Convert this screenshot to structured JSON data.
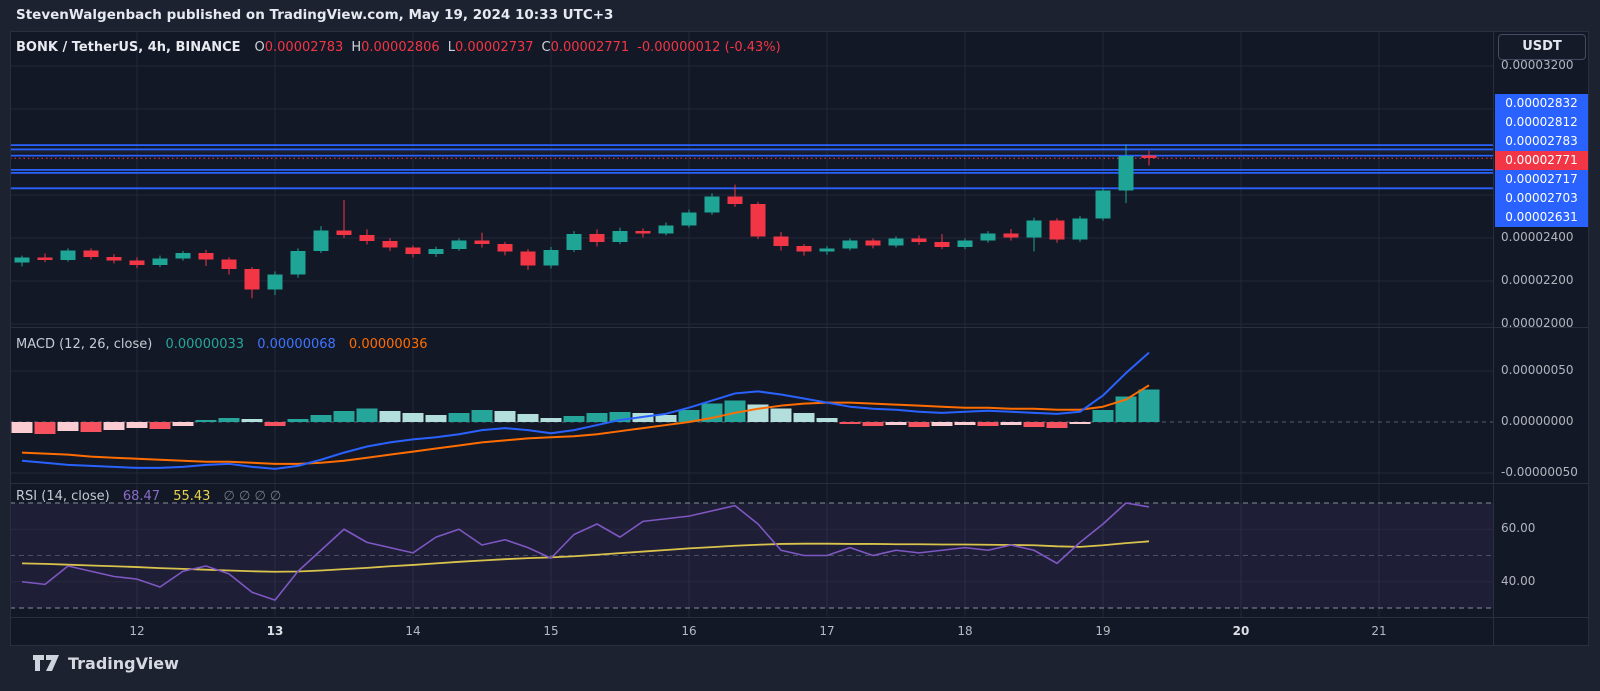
{
  "attribution": "StevenWalgenbach published on TradingView.com, May 19, 2024 10:33 UTC+3",
  "header": {
    "symbol": "BONK / TetherUS, 4h, BINANCE",
    "ohlc": [
      {
        "label": "O",
        "value": "0.00002783"
      },
      {
        "label": "H",
        "value": "0.00002806"
      },
      {
        "label": "L",
        "value": "0.00002737"
      },
      {
        "label": "C",
        "value": "0.00002771"
      }
    ],
    "change": "-0.00000012 (-0.43%)"
  },
  "price_scale_button": "USDT",
  "logo_text": "TradingView",
  "colors": {
    "up": "#1fa595",
    "down": "#f23645",
    "level_line": "#2962ff",
    "level_label_bg": "#2962ff",
    "last_price_bg": "#f23645",
    "macd_line": "#2962ff",
    "signal_line": "#ff6d00",
    "hist_up": "#26a69a",
    "hist_up_weak": "#b2dfdb",
    "hist_down": "#f7525f",
    "hist_down_weak": "#fbcdd2",
    "rsi_line": "#7e57c2",
    "rsi_ma": "#d9c34c",
    "band_fill": "rgba(126,87,194,0.10)",
    "grid": "#212839",
    "axis_text": "#b2b5be"
  },
  "price_axis": {
    "ticks": [
      {
        "value": 3200,
        "label": "0.00003200"
      },
      {
        "value": 2400,
        "label": "0.00002400"
      },
      {
        "value": 2200,
        "label": "0.00002200"
      },
      {
        "value": 2000,
        "label": "0.00002000"
      }
    ],
    "grid_ticks": [
      3200,
      3000,
      2800,
      2600,
      2400,
      2200,
      2000
    ],
    "level_labels": [
      {
        "text": "0.00002832",
        "style": "level"
      },
      {
        "text": "0.00002812",
        "style": "level"
      },
      {
        "text": "0.00002783",
        "style": "level"
      },
      {
        "text": "0.00002771",
        "style": "last"
      },
      {
        "text": "0.00002717",
        "style": "level"
      },
      {
        "text": "0.00002703",
        "style": "level"
      },
      {
        "text": "0.00002631",
        "style": "level"
      }
    ]
  },
  "macd_axis_ticks": [
    {
      "value": 50,
      "label": "0.00000050"
    },
    {
      "value": 0,
      "label": "0.00000000"
    },
    {
      "value": -50,
      "label": "-0.00000050"
    }
  ],
  "rsi_axis_ticks": [
    {
      "value": 60,
      "label": "60.00"
    },
    {
      "value": 40,
      "label": "40.00"
    }
  ],
  "time_axis": {
    "labels": [
      {
        "text": "12",
        "bold": false
      },
      {
        "text": "13",
        "bold": true
      },
      {
        "text": "14",
        "bold": false
      },
      {
        "text": "15",
        "bold": false
      },
      {
        "text": "16",
        "bold": false
      },
      {
        "text": "17",
        "bold": false
      },
      {
        "text": "18",
        "bold": false
      },
      {
        "text": "19",
        "bold": false
      },
      {
        "text": "20",
        "bold": true
      },
      {
        "text": "21",
        "bold": false
      }
    ]
  },
  "macd_legend": {
    "title": "MACD (12, 26, close)",
    "hist_value": "0.00000033",
    "macd_value": "0.00000068",
    "signal_value": "0.00000036"
  },
  "rsi_legend": {
    "title": "RSI (14, close)",
    "rsi_value": "68.47",
    "ma_value": "55.43",
    "empty_slots": "∅  ∅  ∅  ∅"
  },
  "chart_data": [
    {
      "type": "candlestick",
      "title": "BONK / TetherUS, 4h, BINANCE",
      "timeframe": "4h",
      "price_unit": 1e-08,
      "x_axis": {
        "labels": [
          "12",
          "13",
          "14",
          "15",
          "16",
          "17",
          "18",
          "19",
          "20",
          "21"
        ],
        "candles_per_day": 6
      },
      "y_axis": {
        "tick_values": [
          3200,
          2400,
          2200,
          2000
        ]
      },
      "levels": {
        "horizontal_lines": [
          2832,
          2812,
          2783,
          2717,
          2703,
          2631
        ],
        "last_price": 2771
      },
      "candles": [
        [
          2285,
          2318,
          2268,
          2310
        ],
        [
          2310,
          2328,
          2288,
          2298
        ],
        [
          2298,
          2352,
          2290,
          2342
        ],
        [
          2342,
          2352,
          2300,
          2312
        ],
        [
          2312,
          2325,
          2282,
          2295
        ],
        [
          2295,
          2310,
          2260,
          2275
        ],
        [
          2275,
          2318,
          2265,
          2305
        ],
        [
          2305,
          2340,
          2295,
          2330
        ],
        [
          2330,
          2345,
          2270,
          2300
        ],
        [
          2300,
          2310,
          2230,
          2255
        ],
        [
          2255,
          2265,
          2120,
          2160
        ],
        [
          2160,
          2245,
          2135,
          2230
        ],
        [
          2230,
          2352,
          2215,
          2340
        ],
        [
          2340,
          2455,
          2330,
          2435
        ],
        [
          2435,
          2577,
          2400,
          2415
        ],
        [
          2415,
          2440,
          2370,
          2385
        ],
        [
          2385,
          2400,
          2340,
          2355
        ],
        [
          2355,
          2365,
          2310,
          2325
        ],
        [
          2325,
          2360,
          2312,
          2350
        ],
        [
          2350,
          2398,
          2340,
          2388
        ],
        [
          2388,
          2425,
          2355,
          2372
        ],
        [
          2372,
          2382,
          2320,
          2338
        ],
        [
          2338,
          2348,
          2252,
          2272
        ],
        [
          2272,
          2358,
          2258,
          2345
        ],
        [
          2345,
          2432,
          2335,
          2418
        ],
        [
          2418,
          2440,
          2360,
          2382
        ],
        [
          2382,
          2448,
          2372,
          2432
        ],
        [
          2432,
          2445,
          2402,
          2422
        ],
        [
          2422,
          2472,
          2412,
          2458
        ],
        [
          2458,
          2532,
          2448,
          2518
        ],
        [
          2518,
          2608,
          2508,
          2592
        ],
        [
          2592,
          2648,
          2545,
          2558
        ],
        [
          2558,
          2568,
          2395,
          2408
        ],
        [
          2408,
          2428,
          2342,
          2362
        ],
        [
          2362,
          2372,
          2318,
          2338
        ],
        [
          2338,
          2362,
          2322,
          2352
        ],
        [
          2352,
          2398,
          2342,
          2388
        ],
        [
          2388,
          2398,
          2352,
          2366
        ],
        [
          2366,
          2408,
          2356,
          2398
        ],
        [
          2398,
          2412,
          2368,
          2382
        ],
        [
          2382,
          2418,
          2348,
          2358
        ],
        [
          2358,
          2398,
          2348,
          2388
        ],
        [
          2388,
          2432,
          2378,
          2422
        ],
        [
          2422,
          2442,
          2388,
          2402
        ],
        [
          2402,
          2495,
          2338,
          2482
        ],
        [
          2482,
          2492,
          2378,
          2392
        ],
        [
          2392,
          2502,
          2382,
          2490
        ],
        [
          2490,
          2632,
          2480,
          2620
        ],
        [
          2620,
          2835,
          2562,
          2782
        ],
        [
          2783,
          2806,
          2737,
          2771
        ]
      ]
    },
    {
      "type": "macd",
      "title": "MACD (12, 26, close)",
      "value_unit": 1e-09,
      "y_axis": {
        "tick_values": [
          50,
          0,
          -50
        ]
      },
      "histogram": [
        -11,
        -12,
        -9,
        -10,
        -8,
        -6,
        -7,
        -4,
        2,
        4,
        3,
        -4,
        3,
        7,
        11,
        13,
        11,
        9,
        7,
        9,
        12,
        11,
        8,
        4,
        6,
        9,
        10,
        9,
        7,
        12,
        18,
        21,
        17,
        13,
        9,
        4,
        -2,
        -4,
        -3,
        -5,
        -4,
        -3,
        -4,
        -3,
        -5,
        -6,
        -2,
        12,
        25,
        32
      ],
      "macd_line": [
        -38,
        -40,
        -42,
        -43,
        -44,
        -45,
        -45,
        -44,
        -42,
        -41,
        -44,
        -46,
        -43,
        -37,
        -30,
        -24,
        -20,
        -17,
        -15,
        -12,
        -8,
        -6,
        -8,
        -11,
        -8,
        -3,
        2,
        5,
        8,
        14,
        21,
        28,
        30,
        27,
        23,
        19,
        15,
        13,
        12,
        10,
        9,
        10,
        11,
        10,
        9,
        8,
        10,
        26,
        48,
        68
      ],
      "signal_line": [
        -30,
        -31,
        -32,
        -34,
        -35,
        -36,
        -37,
        -38,
        -39,
        -39,
        -40,
        -41,
        -41,
        -40,
        -38,
        -35,
        -32,
        -29,
        -26,
        -23,
        -20,
        -18,
        -16,
        -15,
        -14,
        -12,
        -9,
        -6,
        -3,
        0,
        4,
        9,
        13,
        16,
        18,
        19,
        19,
        18,
        17,
        16,
        15,
        14,
        14,
        13,
        13,
        12,
        12,
        15,
        22,
        36
      ]
    },
    {
      "type": "rsi",
      "title": "RSI (14, close)",
      "y_axis": {
        "tick_values": [
          60,
          40
        ],
        "band_levels": [
          70,
          50,
          30
        ]
      },
      "rsi_line": [
        40,
        39,
        46,
        44,
        42,
        41,
        38,
        44,
        46,
        43,
        36,
        33,
        44,
        52,
        60,
        55,
        53,
        51,
        57,
        60,
        54,
        56,
        53,
        49,
        58,
        62,
        57,
        63,
        64,
        65,
        67,
        69,
        62,
        52,
        50,
        50,
        53,
        50,
        52,
        51,
        52,
        53,
        52,
        54,
        52,
        47,
        55,
        62,
        70,
        68.5
      ],
      "ma_line": [
        47,
        46.8,
        46.5,
        46.2,
        45.9,
        45.6,
        45.2,
        44.9,
        44.6,
        44.3,
        44,
        43.8,
        43.9,
        44.3,
        44.8,
        45.3,
        45.9,
        46.4,
        47,
        47.6,
        48.1,
        48.6,
        49,
        49.3,
        49.7,
        50.3,
        50.9,
        51.5,
        52.1,
        52.7,
        53.2,
        53.7,
        54.1,
        54.4,
        54.5,
        54.5,
        54.4,
        54.4,
        54.3,
        54.3,
        54.2,
        54.2,
        54.1,
        54,
        53.9,
        53.5,
        53.3,
        53.9,
        54.7,
        55.4
      ]
    }
  ]
}
